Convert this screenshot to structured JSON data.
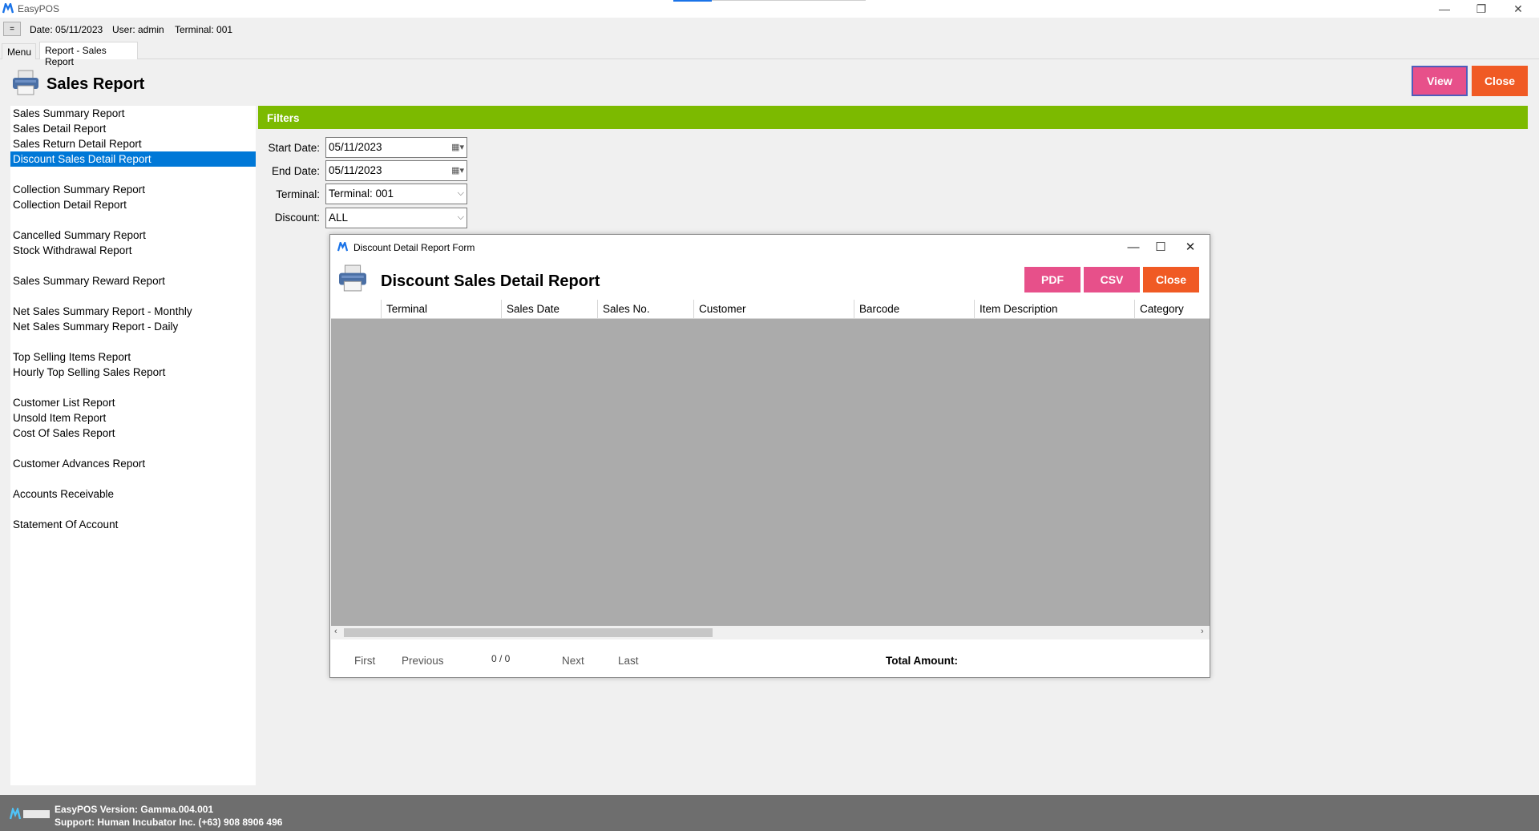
{
  "window": {
    "title": "EasyPOS"
  },
  "infobar": {
    "menu_toggle": "=",
    "date": "Date: 05/11/2023",
    "user": "User: admin",
    "terminal": "Terminal: 001"
  },
  "tabs": [
    {
      "label": "Menu"
    },
    {
      "label": "Report - Sales Report"
    }
  ],
  "header": {
    "title": "Sales Report",
    "view_label": "View",
    "close_label": "Close"
  },
  "colors": {
    "accent_green": "#7cba00",
    "button_pink": "#e7508a",
    "button_orange": "#f05a24",
    "selection_blue": "#0078d7",
    "footer_gray": "#6e6e6e"
  },
  "reports": [
    {
      "label": "Sales Summary Report"
    },
    {
      "label": "Sales Detail Report"
    },
    {
      "label": "Sales Return Detail Report"
    },
    {
      "label": "Discount Sales Detail Report",
      "selected": true
    },
    {
      "label": "Collection Summary Report"
    },
    {
      "label": "Collection Detail Report"
    },
    {
      "label": "Cancelled Summary Report"
    },
    {
      "label": "Stock Withdrawal Report"
    },
    {
      "label": "Sales Summary Reward Report"
    },
    {
      "label": "Net Sales Summary Report - Monthly"
    },
    {
      "label": "Net Sales Summary Report - Daily"
    },
    {
      "label": "Top Selling Items Report"
    },
    {
      "label": "Hourly Top Selling Sales Report"
    },
    {
      "label": "Customer List Report"
    },
    {
      "label": "Unsold Item Report"
    },
    {
      "label": "Cost Of Sales Report"
    },
    {
      "label": "Customer Advances Report"
    },
    {
      "label": "Accounts Receivable"
    },
    {
      "label": "Statement Of Account"
    }
  ],
  "filters": {
    "title": "Filters",
    "start_date_label": "Start Date:",
    "start_date_value": "05/11/2023",
    "end_date_label": "End Date:",
    "end_date_value": "05/11/2023",
    "terminal_label": "Terminal:",
    "terminal_value": "Terminal: 001",
    "discount_label": "Discount:",
    "discount_value": "ALL"
  },
  "inner_form": {
    "window_title": "Discount Detail Report Form",
    "title": "Discount Sales Detail Report",
    "pdf_label": "PDF",
    "csv_label": "CSV",
    "close_label": "Close",
    "columns": [
      "",
      "Terminal",
      "Sales Date",
      "Sales No.",
      "Customer",
      "Barcode",
      "Item Description",
      "Category"
    ],
    "pager": {
      "first": "First",
      "previous": "Previous",
      "count": "0 / 0",
      "next": "Next",
      "last": "Last",
      "total_label": "Total Amount:"
    }
  },
  "footer": {
    "version": "EasyPOS Version: Gamma.004.001",
    "support": "Support: Human Incubator Inc. (+63) 908 8906 496"
  }
}
